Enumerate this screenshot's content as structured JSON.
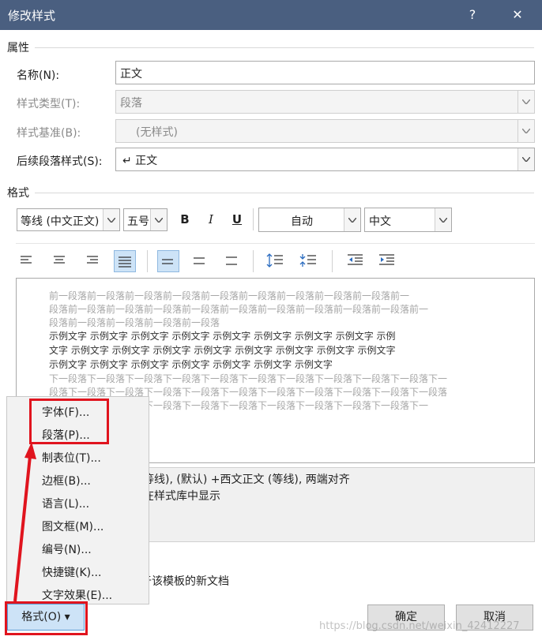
{
  "titlebar": {
    "title": "修改样式",
    "help": "?",
    "close": "✕"
  },
  "properties": {
    "section": "属性",
    "name_label": "名称(N):",
    "name_value": "正文",
    "type_label": "样式类型(T):",
    "type_value": "段落",
    "base_label": "样式基准(B):",
    "base_value": "(无样式)",
    "next_label": "后续段落样式(S):",
    "next_value": "↵ 正文"
  },
  "format": {
    "section": "格式",
    "font": "等线 (中文正文)",
    "size": "五号",
    "bold": "B",
    "italic": "I",
    "underline": "U",
    "color": "自动",
    "lang": "中文"
  },
  "preview": {
    "prev": [
      "前一段落前一段落前一段落前一段落前一段落前一段落前一段落前一段落前一段落前一",
      "段落前一段落前一段落前一段落前一段落前一段落前一段落前一段落前一段落前一段落前一",
      "段落前一段落前一段落前一段落前一段落"
    ],
    "sample": [
      "示例文字  示例文字  示例文字  示例文字  示例文字  示例文字  示例文字  示例文字  示例",
      "文字  示例文字  示例文字  示例文字  示例文字  示例文字  示例文字  示例文字  示例文字",
      "示例文字  示例文字  示例文字  示例文字  示例文字  示例文字  示例文字"
    ],
    "next": [
      "下一段落下一段落下一段落下一段落下一段落下一段落下一段落下一段落下一段落下一段落下一",
      "段落下一段落下一段落下一段落下一段落下一段落下一段落下一段落下一段落下一段落下一段落",
      "段落下一段落下一段落下一段落下一段落下一段落下一段落下一段落下一段落下一段落下一"
    ]
  },
  "description": {
    "line1": "等线), (默认) +西文正文 (等线), 两端对齐",
    "line2": "在样式库中显示",
    "line3": "于该模板的新文档"
  },
  "menu": {
    "items": [
      "字体(F)...",
      "段落(P)...",
      "制表位(T)...",
      "边框(B)...",
      "语言(L)...",
      "图文框(M)...",
      "编号(N)...",
      "快捷键(K)...",
      "文字效果(E)..."
    ]
  },
  "buttons": {
    "format": "格式(O) ▾",
    "ok": "确定",
    "cancel": "取消"
  },
  "watermark": "https://blog.csdn.net/weixin_42412227",
  "colors": {
    "titlebar": "#4a5f80",
    "highlight": "#e0141e",
    "selected": "#cde3f7"
  }
}
